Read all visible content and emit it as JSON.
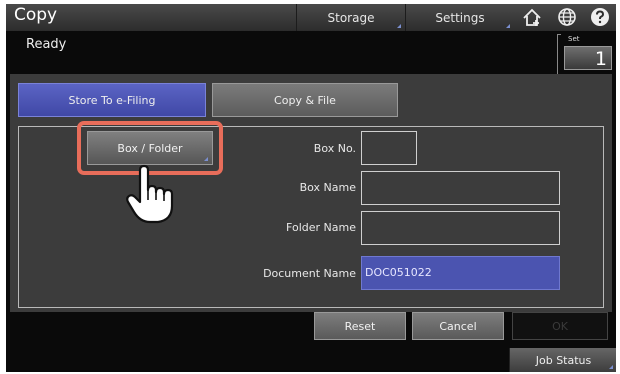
{
  "header": {
    "title": "Copy",
    "storage_label": "Storage",
    "settings_label": "Settings",
    "icons": [
      "home-icon",
      "globe-icon",
      "help-icon"
    ]
  },
  "status": {
    "text": "Ready",
    "set_label": "Set",
    "set_value": "1"
  },
  "tabs": [
    {
      "label": "Store To e-Filing",
      "selected": true
    },
    {
      "label": "Copy & File",
      "selected": false
    }
  ],
  "form": {
    "box_folder_label": "Box / Folder",
    "box_no_label": "Box No.",
    "box_no_value": "",
    "box_name_label": "Box Name",
    "box_name_value": "",
    "folder_name_label": "Folder Name",
    "folder_name_value": "",
    "document_name_label": "Document Name",
    "document_name_value": "DOC051022"
  },
  "actions": {
    "reset_label": "Reset",
    "cancel_label": "Cancel",
    "ok_label": "OK"
  },
  "footer": {
    "job_status_label": "Job Status"
  },
  "colors": {
    "accent": "#4b54b0",
    "highlight": "#e86d5a",
    "background": "#0a0a0a"
  }
}
